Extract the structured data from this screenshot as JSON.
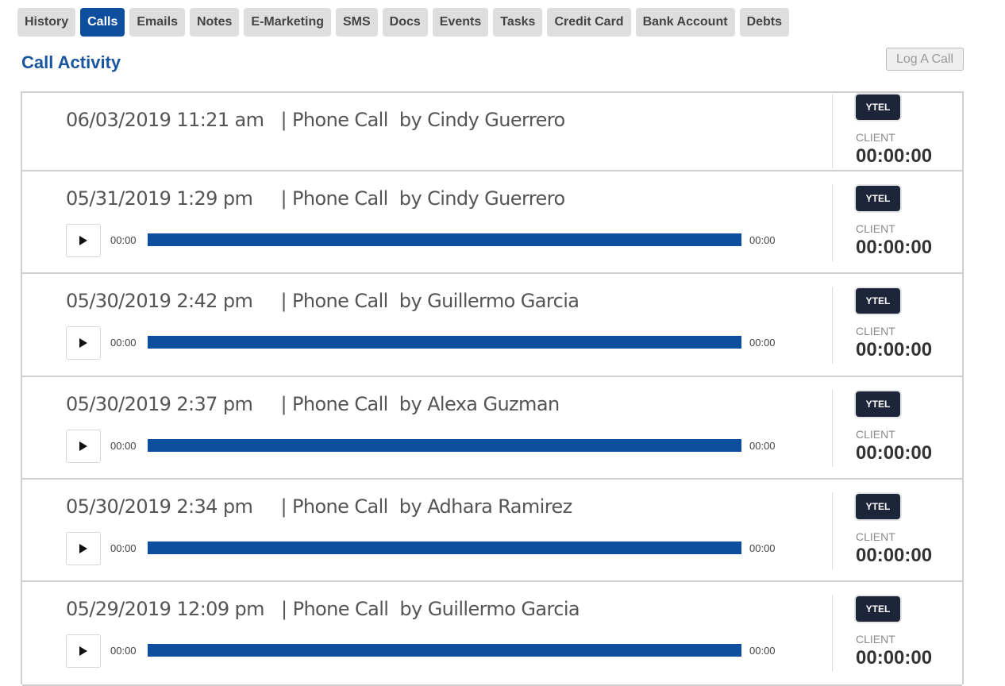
{
  "tabs": [
    {
      "label": "History"
    },
    {
      "label": "Calls",
      "active": true
    },
    {
      "label": "Emails"
    },
    {
      "label": "Notes"
    },
    {
      "label": "E-Marketing"
    },
    {
      "label": "SMS"
    },
    {
      "label": "Docs"
    },
    {
      "label": "Events"
    },
    {
      "label": "Tasks"
    },
    {
      "label": "Credit Card"
    },
    {
      "label": "Bank Account"
    },
    {
      "label": "Debts"
    }
  ],
  "page": {
    "title": "Call Activity",
    "log_call_label": "Log A Call"
  },
  "colors": {
    "accent": "#0d4f9e",
    "title": "#1a55a0",
    "badge_bg": "#1c2539"
  },
  "calls": [
    {
      "datetime": "06/03/2019 11:21 am",
      "type": "Phone Call",
      "by": "Cindy Guerrero",
      "has_recording": false,
      "provider": "YTEL",
      "party": "CLIENT",
      "duration": "00:00:00"
    },
    {
      "datetime": "05/31/2019 1:29 pm",
      "type": "Phone Call",
      "by": "Cindy Guerrero",
      "has_recording": true,
      "player": {
        "elapsed": "00:00",
        "total": "00:00"
      },
      "provider": "YTEL",
      "party": "CLIENT",
      "duration": "00:00:00"
    },
    {
      "datetime": "05/30/2019 2:42 pm",
      "type": "Phone Call",
      "by": "Guillermo Garcia",
      "has_recording": true,
      "player": {
        "elapsed": "00:00",
        "total": "00:00"
      },
      "provider": "YTEL",
      "party": "CLIENT",
      "duration": "00:00:00"
    },
    {
      "datetime": "05/30/2019 2:37 pm",
      "type": "Phone Call",
      "by": "Alexa Guzman",
      "has_recording": true,
      "player": {
        "elapsed": "00:00",
        "total": "00:00"
      },
      "provider": "YTEL",
      "party": "CLIENT",
      "duration": "00:00:00"
    },
    {
      "datetime": "05/30/2019 2:34 pm",
      "type": "Phone Call",
      "by": "Adhara Ramirez",
      "has_recording": true,
      "player": {
        "elapsed": "00:00",
        "total": "00:00"
      },
      "provider": "YTEL",
      "party": "CLIENT",
      "duration": "00:00:00"
    },
    {
      "datetime": "05/29/2019 12:09 pm",
      "type": "Phone Call",
      "by": "Guillermo Garcia",
      "has_recording": true,
      "player": {
        "elapsed": "00:00",
        "total": "00:00"
      },
      "provider": "YTEL",
      "party": "CLIENT",
      "duration": "00:00:00"
    }
  ]
}
